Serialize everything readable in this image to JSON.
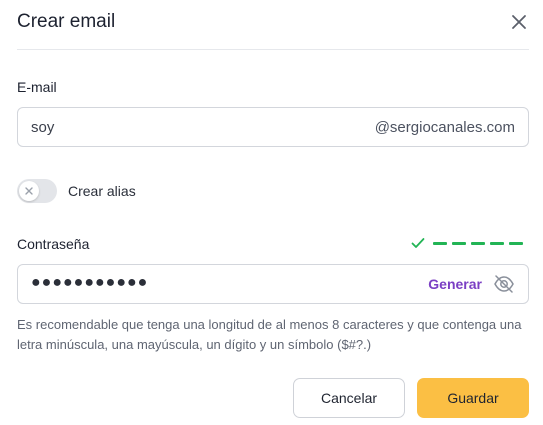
{
  "dialog": {
    "title": "Crear email",
    "close_icon": "close-icon"
  },
  "email": {
    "label": "E-mail",
    "value": "soy",
    "domain": "@sergiocanales.com"
  },
  "alias": {
    "label": "Crear alias",
    "enabled": false
  },
  "password": {
    "label": "Contraseña",
    "masked_value": "●●●●●●●●●●●",
    "generate_label": "Generar",
    "visibility_icon": "eye-off-icon",
    "strength_segments_filled": 5,
    "strength_color": "#22b455"
  },
  "hint": "Es recomendable que tenga una longitud de al menos 8 caracteres y que contenga una letra minúscula, una mayúscula, un dígito y un símbolo ($#?.)",
  "buttons": {
    "cancel": "Cancelar",
    "save": "Guardar"
  },
  "colors": {
    "accent": "#fbbf44",
    "link": "#7b3fc4"
  }
}
